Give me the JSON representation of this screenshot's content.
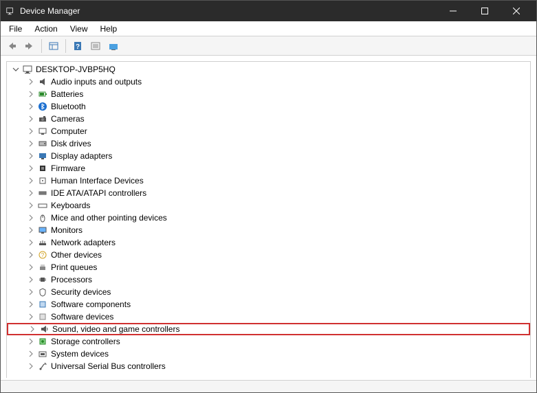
{
  "window": {
    "title": "Device Manager"
  },
  "menu": {
    "file": "File",
    "action": "Action",
    "view": "View",
    "help": "Help"
  },
  "tree": {
    "root": "DESKTOP-JVBP5HQ",
    "items": [
      {
        "label": "Audio inputs and outputs",
        "icon": "audio"
      },
      {
        "label": "Batteries",
        "icon": "battery"
      },
      {
        "label": "Bluetooth",
        "icon": "bluetooth"
      },
      {
        "label": "Cameras",
        "icon": "camera"
      },
      {
        "label": "Computer",
        "icon": "computer"
      },
      {
        "label": "Disk drives",
        "icon": "disk"
      },
      {
        "label": "Display adapters",
        "icon": "display"
      },
      {
        "label": "Firmware",
        "icon": "firmware"
      },
      {
        "label": "Human Interface Devices",
        "icon": "hid"
      },
      {
        "label": "IDE ATA/ATAPI controllers",
        "icon": "ide"
      },
      {
        "label": "Keyboards",
        "icon": "keyboard"
      },
      {
        "label": "Mice and other pointing devices",
        "icon": "mouse"
      },
      {
        "label": "Monitors",
        "icon": "monitor"
      },
      {
        "label": "Network adapters",
        "icon": "network"
      },
      {
        "label": "Other devices",
        "icon": "other"
      },
      {
        "label": "Print queues",
        "icon": "printer"
      },
      {
        "label": "Processors",
        "icon": "cpu"
      },
      {
        "label": "Security devices",
        "icon": "security"
      },
      {
        "label": "Software components",
        "icon": "swcomp"
      },
      {
        "label": "Software devices",
        "icon": "swdev"
      },
      {
        "label": "Sound, video and game controllers",
        "icon": "sound",
        "highlighted": true
      },
      {
        "label": "Storage controllers",
        "icon": "storage"
      },
      {
        "label": "System devices",
        "icon": "system"
      },
      {
        "label": "Universal Serial Bus controllers",
        "icon": "usb"
      }
    ]
  }
}
